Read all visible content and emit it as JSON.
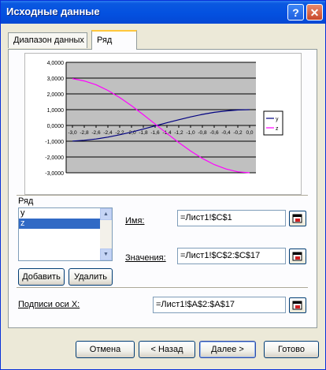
{
  "window": {
    "title": "Исходные данные"
  },
  "titlebar": {
    "help_glyph": "?",
    "close_glyph": "✕"
  },
  "tabs": [
    {
      "label": "Диапазон данных"
    },
    {
      "label": "Ряд"
    }
  ],
  "series_section": {
    "label": "Ряд",
    "items": [
      "y",
      "z"
    ],
    "selected": "z",
    "add_label": "Добавить",
    "delete_label": "Удалить"
  },
  "fields": {
    "name_label": "Имя:",
    "name_value": "=Лист1!$C$1",
    "values_label": "Значения:",
    "values_value": "=Лист1!$C$2:$C$17",
    "xlabels_label": "Подписи оси X:",
    "xlabels_value": "=Лист1!$A$2:$A$17"
  },
  "buttons": {
    "cancel": "Отмена",
    "back": "< Назад",
    "next": "Далее >",
    "finish": "Готово"
  },
  "chart_data": {
    "type": "line",
    "x": [
      "-3,0",
      "-2,8",
      "-2,6",
      "-2,4",
      "-2,2",
      "-2,0",
      "-1,8",
      "-1,6",
      "-1,4",
      "-1,2",
      "-1,0",
      "-0,8",
      "-0,6",
      "-0,4",
      "-0,2",
      "0,0"
    ],
    "series": [
      {
        "name": "y",
        "color": "#000080",
        "values": [
          -0.99,
          -0.94,
          -0.86,
          -0.74,
          -0.59,
          -0.42,
          -0.23,
          -0.03,
          0.17,
          0.36,
          0.54,
          0.7,
          0.83,
          0.92,
          0.98,
          1.0
        ]
      },
      {
        "name": "z",
        "color": "#ff00ff",
        "values": [
          2.97,
          2.82,
          2.58,
          2.22,
          1.77,
          1.25,
          0.68,
          0.09,
          -0.51,
          -1.08,
          -1.62,
          -2.09,
          -2.48,
          -2.76,
          -2.94,
          -3.0
        ]
      }
    ],
    "y_ticks": [
      "4,0000",
      "3,0000",
      "2,0000",
      "1,0000",
      "0,0000",
      "-1,0000",
      "-2,0000",
      "-3,0000"
    ],
    "ylim": [
      -3,
      4
    ],
    "plot_background": "#c0c0c0",
    "grid": true,
    "legend": "right"
  }
}
